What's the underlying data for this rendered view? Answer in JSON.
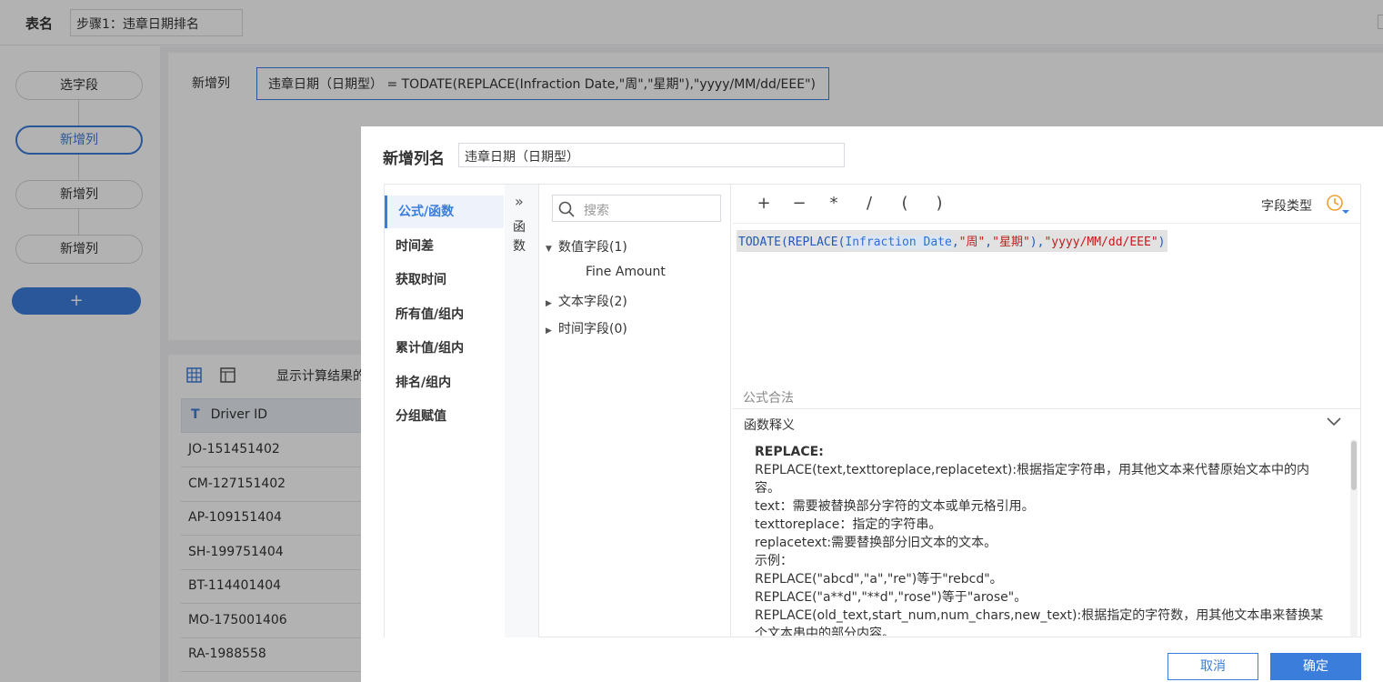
{
  "topbar": {
    "table_label": "表名",
    "table_name": "步骤1：违章日期排名"
  },
  "steps": [
    {
      "label": "选字段"
    },
    {
      "label": "新增列"
    },
    {
      "label": "新增列"
    },
    {
      "label": "新增列"
    }
  ],
  "add_step_label": "+",
  "formula_panel": {
    "new_col_label": "新增列",
    "formula_text": "违章日期（日期型） = TODATE(REPLACE(Infraction Date,\"周\",\"星期\"),\"yyyy/MM/dd/EEE\")"
  },
  "grid": {
    "show_calc_label": "显示计算结果的",
    "column_type_icon": "T",
    "column_header": "Driver ID",
    "rows": [
      "JO-151451402",
      "CM-127151402",
      "AP-109151404",
      "SH-199751404",
      "BT-114401404",
      "MO-175001406",
      "RA-1988558"
    ]
  },
  "dialog": {
    "title": "新增列名",
    "name_value": "违章日期（日期型）",
    "categories": [
      {
        "label": "公式/函数",
        "active": true
      },
      {
        "label": "时间差"
      },
      {
        "label": "获取时间"
      },
      {
        "label": "所有值/组内"
      },
      {
        "label": "累计值/组内"
      },
      {
        "label": "排名/组内"
      },
      {
        "label": "分组赋值"
      }
    ],
    "fn_strip": {
      "arrows": "»",
      "label": "函数"
    },
    "search_placeholder": "搜索",
    "fields": {
      "numeric": "数值字段(1)",
      "numeric_child": "Fine Amount",
      "text": "文本字段(2)",
      "time": "时间字段(0)"
    },
    "operators": [
      "+",
      "−",
      "*",
      "/",
      "(",
      ")"
    ],
    "field_type_label": "字段类型",
    "code": {
      "fn_open": "TODATE(REPLACE(",
      "arg": "Infraction Date",
      "sep1": ",",
      "str1": "\"周\"",
      "sep2": ",",
      "str2": "\"星期\"",
      "sep3": "),",
      "str3": "\"yyyy/MM/dd/EEE\"",
      "close": ")"
    },
    "valid_text": "公式合法",
    "desc_label": "函数释义",
    "desc_lines": [
      "REPLACE:",
      "REPLACE(text,texttoreplace,replacetext):根据指定字符串，用其他文本来代替原始文本中的内容。",
      "text：需要被替换部分字符的文本或单元格引用。",
      "texttoreplace：指定的字符串。",
      "replacetext:需要替换部分旧文本的文本。",
      "示例：",
      "REPLACE(\"abcd\",\"a\",\"re\")等于\"rebcd\"。",
      "REPLACE(\"a**d\",\"**d\",\"rose\")等于\"arose\"。",
      "REPLACE(old_text,start_num,num_chars,new_text):根据指定的字符数，用其他文本串来替换某个文本串中的部分内容。"
    ],
    "cancel_label": "取消",
    "ok_label": "确定",
    "accent_color": "#3b7ddb",
    "clock_color": "#f0a030"
  }
}
